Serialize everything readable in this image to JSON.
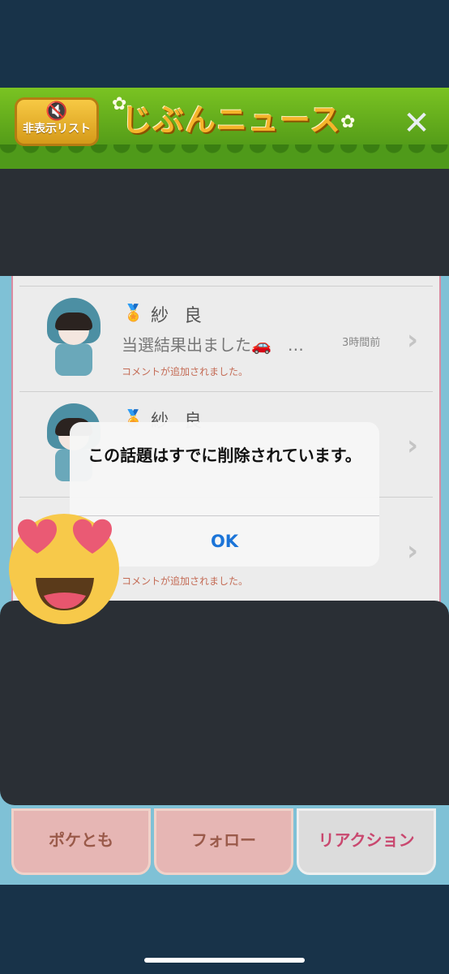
{
  "header": {
    "hide_list_label": "非表示リスト",
    "title": "じぶんニュース",
    "close_icon": "close-icon"
  },
  "feed": [
    {
      "name": "紗 良",
      "message": "当選結果出ました🚗　…",
      "time": "3時間前",
      "note": "コメントが追加されました。"
    },
    {
      "name": "紗 良",
      "message": "",
      "time": "",
      "note": ""
    },
    {
      "name": "",
      "message": "",
      "time": "",
      "note": "コメントが追加されました。"
    }
  ],
  "alert": {
    "message": "この話題はすでに削除されています。",
    "ok_label": "OK"
  },
  "tabs": {
    "poketomo": "ポケとも",
    "follow": "フォロー",
    "reaction": "リアクション"
  },
  "colors": {
    "accent": "#1b74d8",
    "header_green": "#5aa21a",
    "title_gold": "#f5b42a",
    "redaction": "#2a2f35",
    "active_tab_text": "#c9486f"
  }
}
